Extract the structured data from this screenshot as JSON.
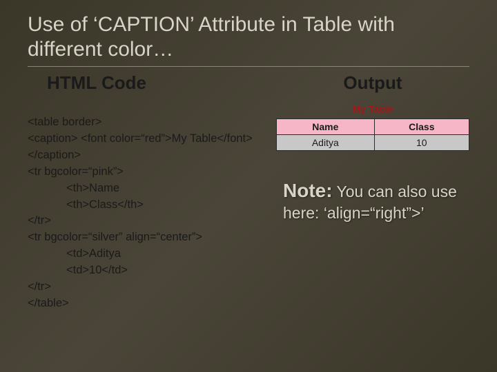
{
  "title": "Use of ‘CAPTION’ Attribute in Table with different color…",
  "left_heading": "HTML Code",
  "right_heading": "Output",
  "code": {
    "l1": "<table border>",
    "l2": "<caption> <font color=“red”>My Table</font></caption>",
    "l3": "<tr bgcolor=“pink”>",
    "l4": "<th>Name",
    "l5": "<th>Class</th>",
    "l6": "</tr>",
    "l7": "<tr bgcolor=“silver” align=“center”>",
    "l8": "<td>Aditya",
    "l9": "<td>10</td>",
    "l10": "</tr>",
    "l11": "</table>"
  },
  "output_table": {
    "caption": "My Table",
    "headers": [
      "Name",
      "Class"
    ],
    "row": [
      "Aditya",
      "10"
    ]
  },
  "note_label": "Note:",
  "note_text": "You can also use here: ‘align=“right”>’",
  "chart_data": {
    "type": "table",
    "title": "My Table",
    "headers": [
      "Name",
      "Class"
    ],
    "rows": [
      [
        "Aditya",
        "10"
      ]
    ]
  }
}
